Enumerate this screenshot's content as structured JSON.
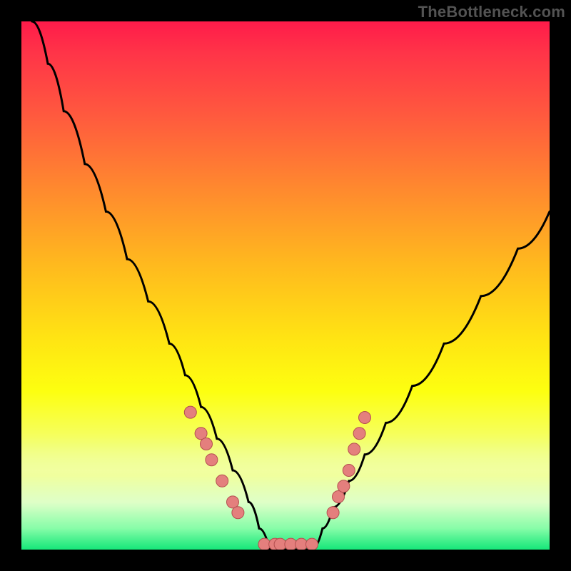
{
  "watermark": "TheBottleneck.com",
  "colors": {
    "dot_fill": "#e47f7d",
    "dot_stroke": "#b44f4f",
    "stroke": "#000000"
  },
  "chart_data": {
    "type": "line",
    "title": "",
    "xlabel": "",
    "ylabel": "",
    "xlim": [
      0,
      100
    ],
    "ylim": [
      0,
      100
    ],
    "grid": false,
    "legend": false,
    "series": [
      {
        "name": "left-branch",
        "x": [
          2,
          5,
          8,
          12,
          16,
          20,
          24,
          28,
          31,
          34,
          37,
          40,
          43,
          45,
          47
        ],
        "values": [
          100,
          92,
          83,
          73,
          64,
          55,
          47,
          39,
          33,
          27,
          21,
          15,
          9,
          4,
          0
        ]
      },
      {
        "name": "right-branch",
        "x": [
          55,
          57,
          59,
          62,
          65,
          69,
          74,
          80,
          87,
          94,
          100
        ],
        "values": [
          0,
          4,
          8,
          13,
          18,
          24,
          31,
          39,
          48,
          57,
          64
        ]
      }
    ],
    "dots": {
      "comment": "approximate salmon marker positions (x,y in 0–100 chart space)",
      "points": [
        [
          32,
          26
        ],
        [
          34,
          22
        ],
        [
          35,
          20
        ],
        [
          36,
          17
        ],
        [
          38,
          13
        ],
        [
          40,
          9
        ],
        [
          41,
          7
        ],
        [
          46,
          1
        ],
        [
          48,
          1
        ],
        [
          49,
          1
        ],
        [
          51,
          1
        ],
        [
          53,
          1
        ],
        [
          55,
          1
        ],
        [
          59,
          7
        ],
        [
          60,
          10
        ],
        [
          61,
          12
        ],
        [
          62,
          15
        ],
        [
          63,
          19
        ],
        [
          64,
          22
        ],
        [
          65,
          25
        ]
      ]
    },
    "valley_x_range": [
      45,
      56
    ]
  }
}
